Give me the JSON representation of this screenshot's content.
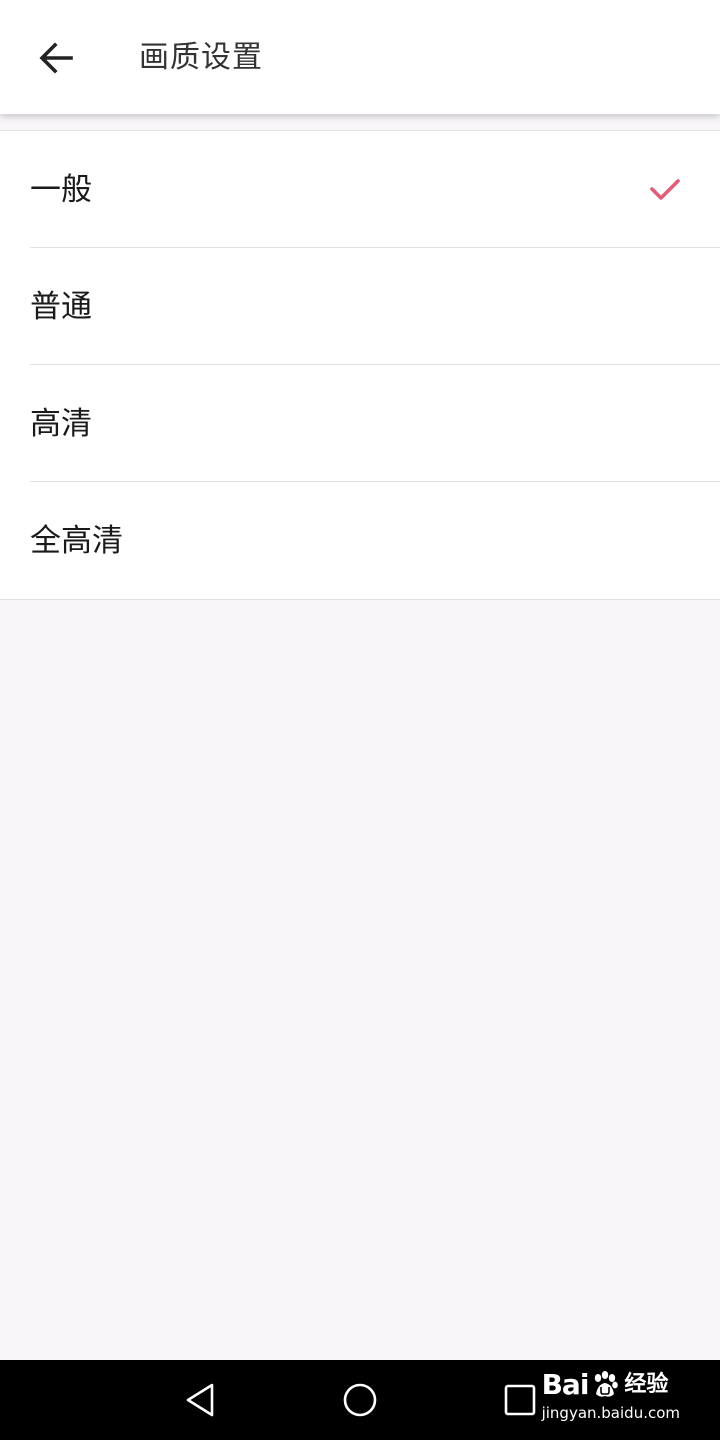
{
  "header": {
    "title": "画质设置",
    "back_icon": "arrow-left-icon"
  },
  "options": [
    {
      "label": "一般",
      "selected": true
    },
    {
      "label": "普通",
      "selected": false
    },
    {
      "label": "高清",
      "selected": false
    },
    {
      "label": "全高清",
      "selected": false
    }
  ],
  "colors": {
    "accent_check": "#e05d78",
    "background": "#f8f6f9",
    "surface": "#ffffff",
    "divider": "#e4e2e5"
  },
  "nav_bar": {
    "icons": [
      "back-triangle-icon",
      "home-circle-icon",
      "recents-square-icon"
    ]
  },
  "watermark": {
    "brand_prefix": "Bai",
    "brand_suffix": "经验",
    "url": "jingyan.baidu.com"
  }
}
